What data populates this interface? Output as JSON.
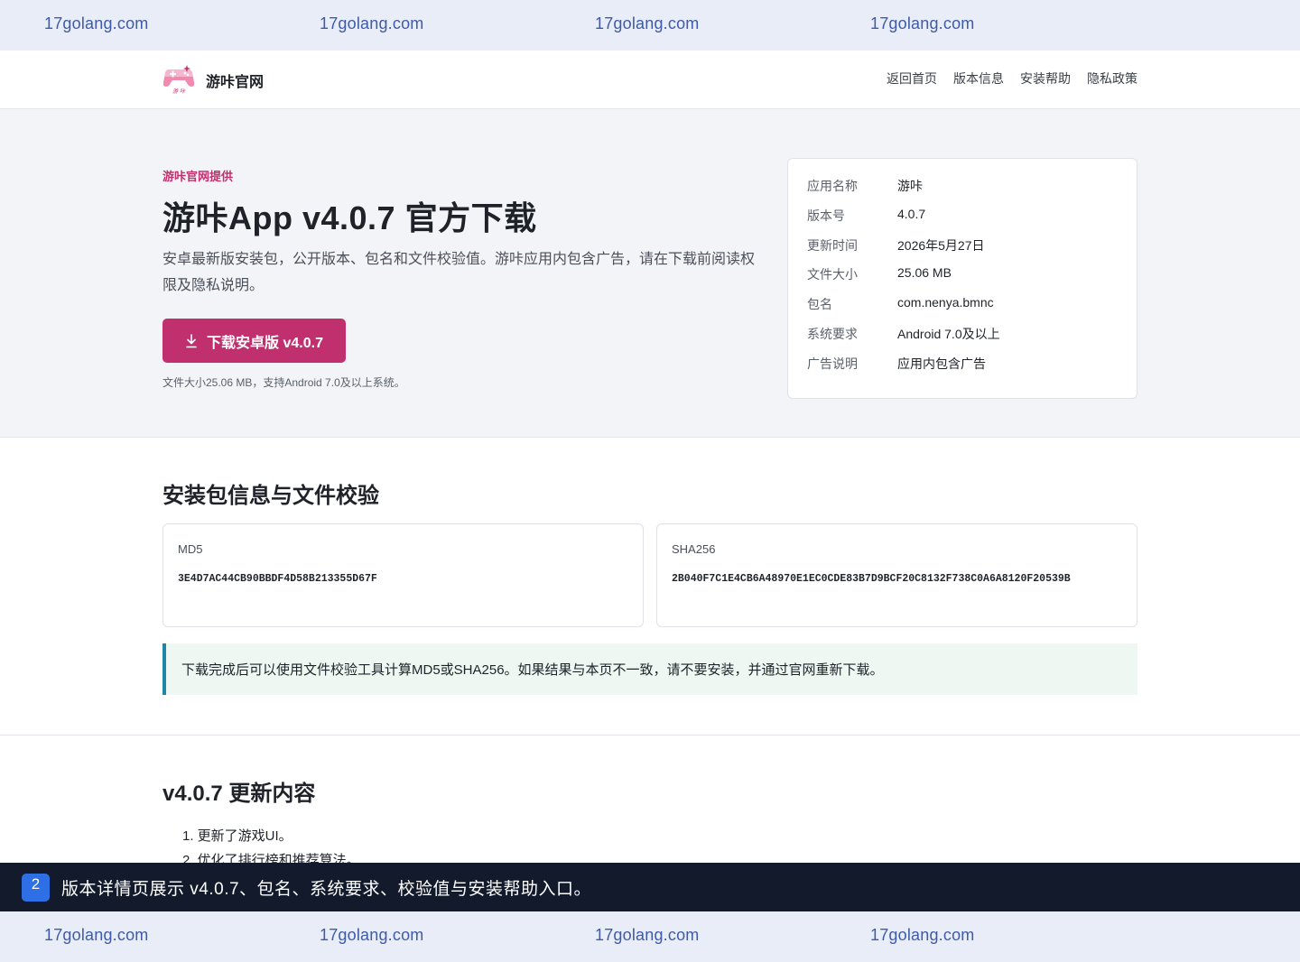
{
  "watermark": {
    "items": [
      "17golang.com",
      "17golang.com",
      "17golang.com",
      "17golang.com"
    ]
  },
  "header": {
    "logo_icon": "gamepad-logo-icon",
    "brand": "游咔官网",
    "nav": [
      "返回首页",
      "版本信息",
      "安装帮助",
      "隐私政策"
    ]
  },
  "hero": {
    "eyebrow": "游咔官网提供",
    "title": "游咔App v4.0.7 官方下载",
    "description": "安卓最新版安装包，公开版本、包名和文件校验值。游咔应用内包含广告，请在下载前阅读权限及隐私说明。",
    "download_icon": "download-icon",
    "download_label": "下载安卓版 v4.0.7",
    "note": "文件大小25.06 MB，支持Android 7.0及以上系统。"
  },
  "info": [
    {
      "key": "应用名称",
      "value": "游咔"
    },
    {
      "key": "版本号",
      "value": "4.0.7"
    },
    {
      "key": "更新时间",
      "value": "2026年5月27日"
    },
    {
      "key": "文件大小",
      "value": "25.06 MB"
    },
    {
      "key": "包名",
      "value": "com.nenya.bmnc"
    },
    {
      "key": "系统要求",
      "value": "Android 7.0及以上"
    },
    {
      "key": "广告说明",
      "value": "应用内包含广告"
    }
  ],
  "checksum": {
    "title": "安装包信息与文件校验",
    "md5_label": "MD5",
    "md5_value": "3E4D7AC44CB90BBDF4D58B213355D67F",
    "sha_label": "SHA256",
    "sha_value": "2B040F7C1E4CB6A48970E1EC0CDE83B7D9BCF20C8132F738C0A6A8120F20539B",
    "tip": "下载完成后可以使用文件校验工具计算MD5或SHA256。如果结果与本页不一致，请不要安装，并通过官网重新下载。"
  },
  "changelog": {
    "title": "v4.0.7 更新内容",
    "items": [
      "1. 更新了游戏UI。",
      "2. 优化了排行榜和推荐算法。"
    ]
  },
  "caption": {
    "number": "2",
    "text": "版本详情页展示 v4.0.7、包名、系统要求、校验值与安装帮助入口。"
  },
  "colors": {
    "accent": "#c0306e",
    "tip_border": "#1e86a6",
    "caption_bg": "#121a2b",
    "caption_badge": "#2f6fe6"
  }
}
